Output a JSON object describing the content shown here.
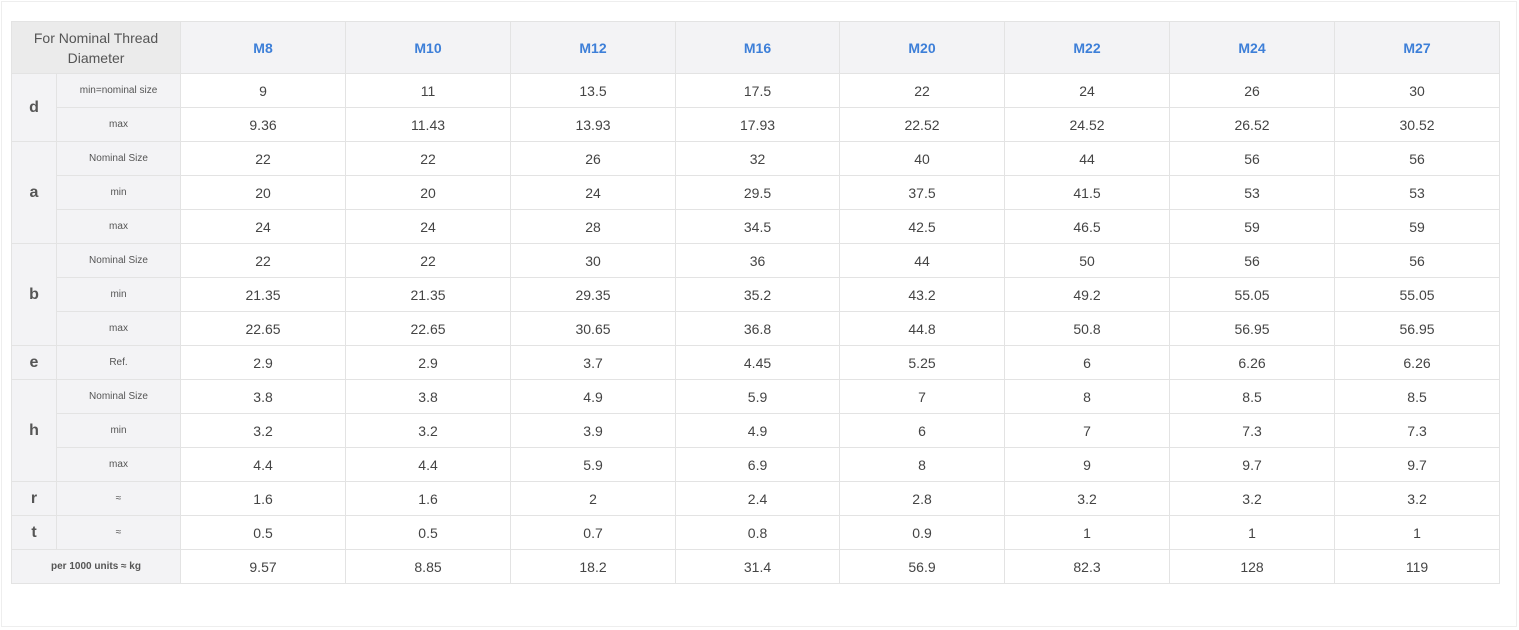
{
  "table": {
    "corner_label": "For Nominal Thread Diameter",
    "columns": [
      "M8",
      "M10",
      "M12",
      "M16",
      "M20",
      "M22",
      "M24",
      "M27"
    ],
    "groups": [
      {
        "label": "d",
        "rows": [
          {
            "sub": "min=nominal size",
            "values": [
              "9",
              "11",
              "13.5",
              "17.5",
              "22",
              "24",
              "26",
              "30"
            ]
          },
          {
            "sub": "max",
            "values": [
              "9.36",
              "11.43",
              "13.93",
              "17.93",
              "22.52",
              "24.52",
              "26.52",
              "30.52"
            ]
          }
        ]
      },
      {
        "label": "a",
        "rows": [
          {
            "sub": "Nominal Size",
            "values": [
              "22",
              "22",
              "26",
              "32",
              "40",
              "44",
              "56",
              "56"
            ]
          },
          {
            "sub": "min",
            "values": [
              "20",
              "20",
              "24",
              "29.5",
              "37.5",
              "41.5",
              "53",
              "53"
            ]
          },
          {
            "sub": "max",
            "values": [
              "24",
              "24",
              "28",
              "34.5",
              "42.5",
              "46.5",
              "59",
              "59"
            ]
          }
        ]
      },
      {
        "label": "b",
        "rows": [
          {
            "sub": "Nominal Size",
            "values": [
              "22",
              "22",
              "30",
              "36",
              "44",
              "50",
              "56",
              "56"
            ]
          },
          {
            "sub": "min",
            "values": [
              "21.35",
              "21.35",
              "29.35",
              "35.2",
              "43.2",
              "49.2",
              "55.05",
              "55.05"
            ]
          },
          {
            "sub": "max",
            "values": [
              "22.65",
              "22.65",
              "30.65",
              "36.8",
              "44.8",
              "50.8",
              "56.95",
              "56.95"
            ]
          }
        ]
      },
      {
        "label": "e",
        "rows": [
          {
            "sub": "Ref.",
            "values": [
              "2.9",
              "2.9",
              "3.7",
              "4.45",
              "5.25",
              "6",
              "6.26",
              "6.26"
            ]
          }
        ]
      },
      {
        "label": "h",
        "rows": [
          {
            "sub": "Nominal Size",
            "values": [
              "3.8",
              "3.8",
              "4.9",
              "5.9",
              "7",
              "8",
              "8.5",
              "8.5"
            ]
          },
          {
            "sub": "min",
            "values": [
              "3.2",
              "3.2",
              "3.9",
              "4.9",
              "6",
              "7",
              "7.3",
              "7.3"
            ]
          },
          {
            "sub": "max",
            "values": [
              "4.4",
              "4.4",
              "5.9",
              "6.9",
              "8",
              "9",
              "9.7",
              "9.7"
            ]
          }
        ]
      },
      {
        "label": "r",
        "rows": [
          {
            "sub": "≈",
            "values": [
              "1.6",
              "1.6",
              "2",
              "2.4",
              "2.8",
              "3.2",
              "3.2",
              "3.2"
            ]
          }
        ]
      },
      {
        "label": "t",
        "rows": [
          {
            "sub": "≈",
            "values": [
              "0.5",
              "0.5",
              "0.7",
              "0.8",
              "0.9",
              "1",
              "1",
              "1"
            ]
          }
        ]
      }
    ],
    "weight_row": {
      "label": "per 1000 units ≈ kg",
      "values": [
        "9.57",
        "8.85",
        "18.2",
        "31.4",
        "56.9",
        "82.3",
        "128",
        "119"
      ]
    },
    "colors": {
      "header_text": "#3d7fd8",
      "header_bg": "#f3f3f5",
      "corner_bg": "#ebebeb",
      "border": "#e3e3e3",
      "value_text": "#444444"
    }
  }
}
